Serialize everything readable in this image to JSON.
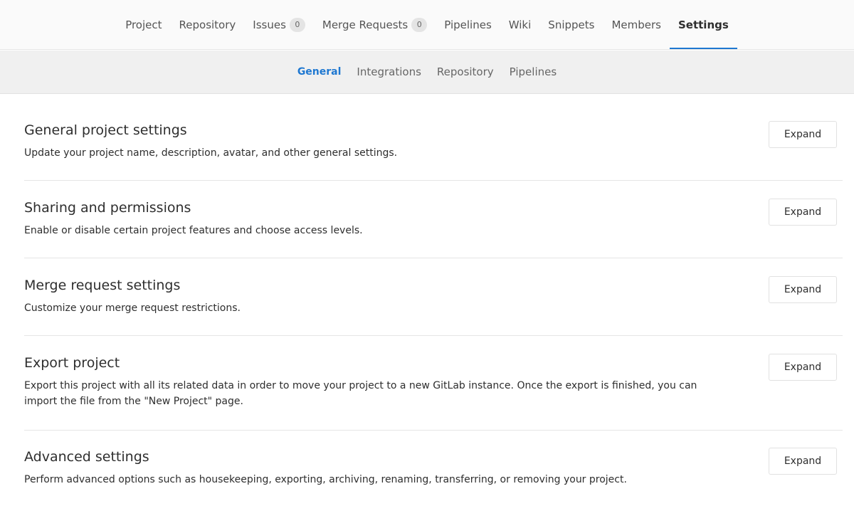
{
  "project_nav": {
    "tabs": [
      {
        "label": "Project"
      },
      {
        "label": "Repository"
      },
      {
        "label": "Issues",
        "count": "0"
      },
      {
        "label": "Merge Requests",
        "count": "0"
      },
      {
        "label": "Pipelines"
      },
      {
        "label": "Wiki"
      },
      {
        "label": "Snippets"
      },
      {
        "label": "Members"
      },
      {
        "label": "Settings",
        "active": true
      }
    ]
  },
  "settings_nav": {
    "tabs": [
      {
        "label": "General",
        "active": true
      },
      {
        "label": "Integrations"
      },
      {
        "label": "Repository"
      },
      {
        "label": "Pipelines"
      }
    ]
  },
  "sections": [
    {
      "title": "General project settings",
      "description": "Update your project name, description, avatar, and other general settings.",
      "button": "Expand"
    },
    {
      "title": "Sharing and permissions",
      "description": "Enable or disable certain project features and choose access levels.",
      "button": "Expand"
    },
    {
      "title": "Merge request settings",
      "description": "Customize your merge request restrictions.",
      "button": "Expand"
    },
    {
      "title": "Export project",
      "description": "Export this project with all its related data in order to move your project to a new GitLab instance. Once the export is finished, you can import the file from the \"New Project\" page.",
      "button": "Expand"
    },
    {
      "title": "Advanced settings",
      "description": "Perform advanced options such as housekeeping, exporting, archiving, renaming, transferring, or removing your project.",
      "button": "Expand"
    }
  ],
  "colors": {
    "accent": "#1f78d1",
    "nav_background": "#fafafa",
    "subnav_background": "#f0f0f0",
    "badge_background": "#e4e4e4"
  }
}
